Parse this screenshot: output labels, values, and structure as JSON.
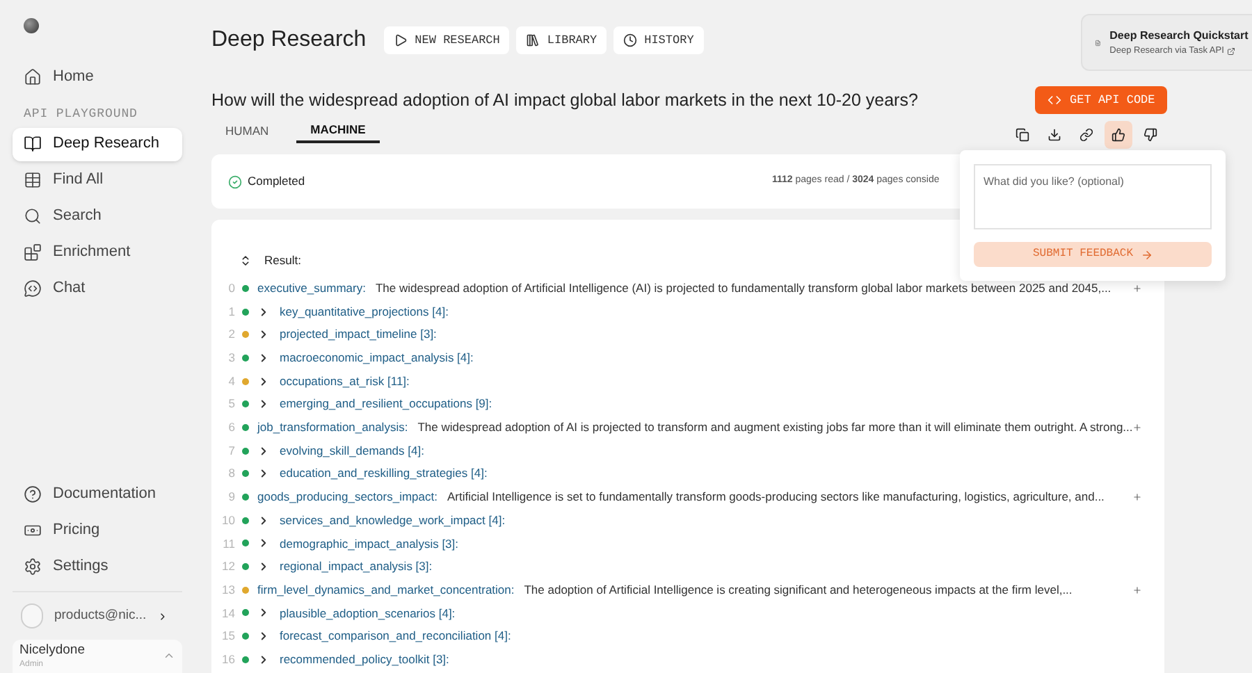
{
  "sidebar": {
    "top_items": [
      {
        "label": "Home",
        "selected": false
      }
    ],
    "section_title": "API PLAYGROUND",
    "items": [
      {
        "label": "Deep Research",
        "selected": true
      },
      {
        "label": "Find All",
        "selected": false
      },
      {
        "label": "Search",
        "selected": false
      },
      {
        "label": "Enrichment",
        "selected": false
      },
      {
        "label": "Chat",
        "selected": false
      }
    ],
    "bottom_items": [
      {
        "label": "Documentation",
        "selected": false
      },
      {
        "label": "Pricing",
        "selected": false
      },
      {
        "label": "Settings",
        "selected": false
      }
    ],
    "account": {
      "email": "products@nic..."
    },
    "org": {
      "name": "Nicelydone",
      "role": "Admin"
    }
  },
  "header": {
    "title": "Deep Research",
    "buttons": [
      "NEW RESEARCH",
      "LIBRARY",
      "HISTORY"
    ],
    "quickstart": {
      "title": "Deep Research Quickstart",
      "link": "Deep Research via Task API"
    }
  },
  "question": "How will the widespread adoption of AI impact global labor markets in the next 10-20 years?",
  "api_button": "GET API CODE",
  "tabs": [
    {
      "label": "HUMAN",
      "selected": false
    },
    {
      "label": "MACHINE",
      "selected": true
    }
  ],
  "actions": [
    {
      "kind": "copy",
      "selected": false
    },
    {
      "kind": "download",
      "selected": false
    },
    {
      "kind": "link",
      "selected": false
    },
    {
      "kind": "like",
      "selected": true
    },
    {
      "kind": "dislike",
      "selected": false
    }
  ],
  "status": {
    "label": "Completed",
    "stats": "**1112** pages read / **3024** pages conside"
  },
  "feedback": {
    "placeholder": "What did you like? (optional)",
    "submit": "SUBMIT FEEDBACK"
  },
  "result": {
    "label": "Result:",
    "rows": [
      {
        "index": "0",
        "color": "#22a35a",
        "key": "executive_summary:",
        "value": "The widespread adoption of Artificial Intelligence (AI) is projected to fundamentally transform global labor markets between 2025 and 2045,...",
        "children": [
          {
            "index": "1",
            "color": "#22a35a",
            "key": "key_quantitative_projections [4]:"
          },
          {
            "index": "2",
            "color": "#e0a82e",
            "key": "projected_impact_timeline [3]:"
          },
          {
            "index": "3",
            "color": "#22a35a",
            "key": "macroeconomic_impact_analysis [4]:"
          },
          {
            "index": "4",
            "color": "#e0a82e",
            "key": "occupations_at_risk [11]:"
          },
          {
            "index": "5",
            "color": "#22a35a",
            "key": "emerging_and_resilient_occupations [9]:"
          }
        ]
      },
      {
        "index": "6",
        "color": "#22a35a",
        "key": "job_transformation_analysis:",
        "value": "The widespread adoption of AI is projected to transform and augment existing jobs far more than it will eliminate them outright. A strong...",
        "children": [
          {
            "index": "7",
            "color": "#22a35a",
            "key": "evolving_skill_demands [4]:"
          },
          {
            "index": "8",
            "color": "#22a35a",
            "key": "education_and_reskilling_strategies [4]:"
          }
        ]
      },
      {
        "index": "9",
        "color": "#22a35a",
        "key": "goods_producing_sectors_impact:",
        "value": "Artificial Intelligence is set to fundamentally transform goods-producing sectors like manufacturing, logistics, agriculture, and...",
        "children": [
          {
            "index": "10",
            "color": "#22a35a",
            "key": "services_and_knowledge_work_impact [4]:"
          },
          {
            "index": "11",
            "color": "#22a35a",
            "key": "demographic_impact_analysis [3]:"
          },
          {
            "index": "12",
            "color": "#22a35a",
            "key": "regional_impact_analysis [3]:"
          }
        ]
      },
      {
        "index": "13",
        "color": "#e0a82e",
        "key": "firm_level_dynamics_and_market_concentration:",
        "value": "The adoption of Artificial Intelligence is creating significant and heterogeneous impacts at the firm level,...",
        "children": [
          {
            "index": "14",
            "color": "#22a35a",
            "key": "plausible_adoption_scenarios [4]:"
          },
          {
            "index": "15",
            "color": "#22a35a",
            "key": "forecast_comparison_and_reconciliation [4]:"
          },
          {
            "index": "16",
            "color": "#22a35a",
            "key": "recommended_policy_toolkit [3]:"
          }
        ]
      }
    ]
  }
}
